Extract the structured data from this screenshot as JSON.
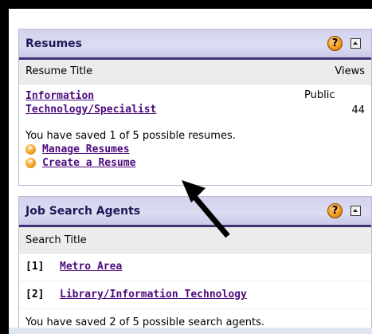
{
  "resumes": {
    "title": "Resumes",
    "help_label": "?",
    "col_title": "Resume Title",
    "col_views": "Views",
    "items": [
      {
        "title_line1": "Information",
        "title_line2": "Technology/Specialist",
        "status": "Public",
        "views": "44"
      }
    ],
    "saved_text": "You have saved 1 of 5 possible resumes.",
    "actions": [
      {
        "label": "Manage Resumes"
      },
      {
        "label": "Create a Resume"
      }
    ]
  },
  "agents": {
    "title": "Job Search Agents",
    "help_label": "?",
    "col_title": "Search Title",
    "items": [
      {
        "num": "[1]",
        "label": "Metro Area"
      },
      {
        "num": "[2]",
        "label": "Library/Information Technology"
      }
    ],
    "saved_text": "You have saved 2 of 5 possible search agents."
  },
  "colors": {
    "header_bg": "#d2d2ee",
    "header_underline": "#3b3578",
    "link": "#4b0a7d",
    "help_icon": "#f39a1c"
  },
  "icons": [
    "help-icon",
    "collapse-icon",
    "bullet-arrow-icon",
    "pointer-arrow-icon"
  ]
}
